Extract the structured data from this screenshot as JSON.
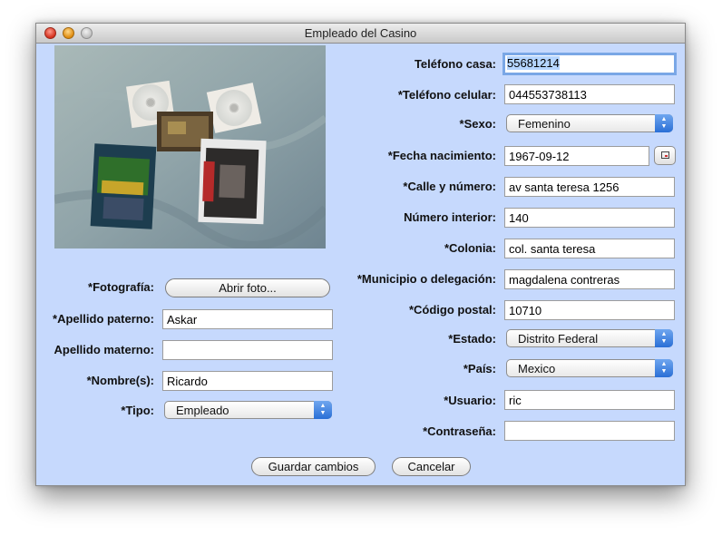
{
  "window": {
    "title": "Empleado del Casino"
  },
  "left": {
    "foto_label": "*Fotografía:",
    "foto_button": "Abrir foto...",
    "apellido_paterno": {
      "label": "*Apellido paterno:",
      "value": "Askar"
    },
    "apellido_materno": {
      "label": "Apellido materno:",
      "value": ""
    },
    "nombre": {
      "label": "*Nombre(s):",
      "value": "Ricardo"
    },
    "tipo": {
      "label": "*Tipo:",
      "value": "Empleado"
    }
  },
  "right": {
    "telefono_casa": {
      "label": "Teléfono casa:",
      "value": "55681214"
    },
    "telefono_celular": {
      "label": "*Teléfono celular:",
      "value": "044553738113"
    },
    "sexo": {
      "label": "*Sexo:",
      "value": "Femenino"
    },
    "fecha_nacimiento": {
      "label": "*Fecha nacimiento:",
      "value": "1967-09-12"
    },
    "calle": {
      "label": "*Calle y número:",
      "value": "av santa teresa 1256"
    },
    "numero_interior": {
      "label": "Número interior:",
      "value": "140"
    },
    "colonia": {
      "label": "*Colonia:",
      "value": "col. santa teresa"
    },
    "municipio": {
      "label": "*Municipio o delegación:",
      "value": "magdalena contreras"
    },
    "codigo_postal": {
      "label": "*Código postal:",
      "value": "10710"
    },
    "estado": {
      "label": "*Estado:",
      "value": "Distrito Federal"
    },
    "pais": {
      "label": "*País:",
      "value": "Mexico"
    },
    "usuario": {
      "label": "*Usuario:",
      "value": "ric"
    },
    "contrasena": {
      "label": "*Contraseña:",
      "value": ""
    }
  },
  "buttons": {
    "guardar": "Guardar cambios",
    "cancelar": "Cancelar"
  },
  "icons": {
    "calendar": "calendar-icon",
    "combo": "up-down-arrows-icon"
  },
  "colors": {
    "window_bg": "#c6d9fd",
    "combo_accent": "#2a6fd6",
    "focus_ring": "#7aa7e6"
  }
}
